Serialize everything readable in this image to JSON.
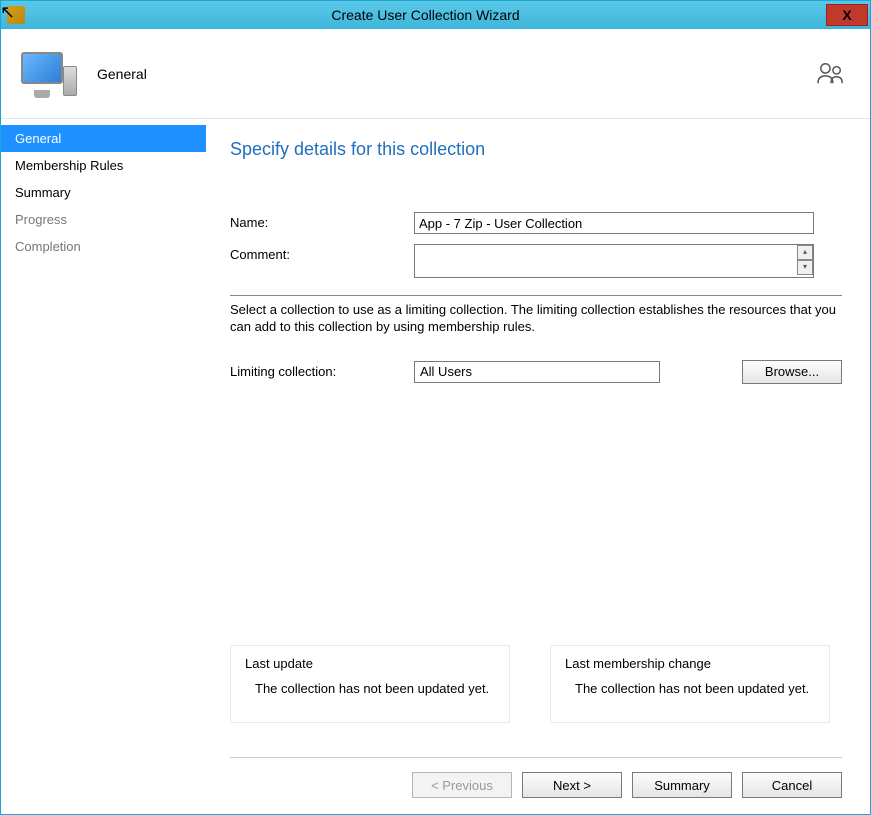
{
  "window": {
    "title": "Create User Collection Wizard"
  },
  "header": {
    "title": "General"
  },
  "sidebar": {
    "steps": [
      {
        "label": "General",
        "state": "active"
      },
      {
        "label": "Membership Rules",
        "state": "normal"
      },
      {
        "label": "Summary",
        "state": "normal"
      },
      {
        "label": "Progress",
        "state": "muted"
      },
      {
        "label": "Completion",
        "state": "muted"
      }
    ]
  },
  "main": {
    "heading": "Specify details for this collection",
    "name_label": "Name:",
    "name_value": "App - 7 Zip - User Collection",
    "comment_label": "Comment:",
    "comment_value": "",
    "help_text": "Select a collection to use as a limiting collection. The limiting collection establishes the resources that you can add to this collection by using membership rules.",
    "limiting_label": "Limiting collection:",
    "limiting_value": "All Users",
    "browse_label": "Browse...",
    "status": {
      "last_update_title": "Last update",
      "last_update_text": "The collection has not been updated yet.",
      "last_membership_title": "Last membership change",
      "last_membership_text": "The collection has not been updated yet."
    }
  },
  "footer": {
    "previous": "< Previous",
    "next": "Next >",
    "summary": "Summary",
    "cancel": "Cancel"
  }
}
